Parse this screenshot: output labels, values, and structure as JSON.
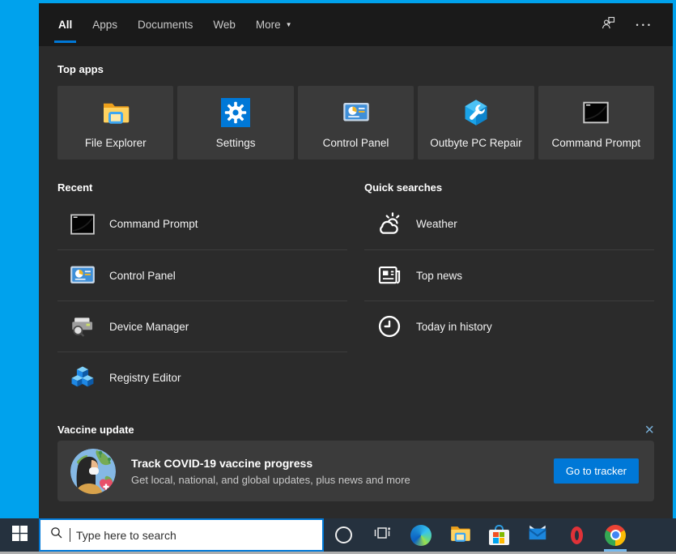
{
  "colors": {
    "desktop_blue": "#00a2ed",
    "accent_blue": "#0078d7",
    "panel_bg": "#2b2b2b",
    "tabbar_bg": "#1a1a1a",
    "tile_bg": "#3a3a3a",
    "taskbar_bg": "#25313e",
    "active_app_underline": "#76b9ed",
    "close_icon_blue": "#78aed6"
  },
  "search_panel": {
    "tabs": [
      {
        "label": "All",
        "active": true
      },
      {
        "label": "Apps",
        "active": false
      },
      {
        "label": "Documents",
        "active": false
      },
      {
        "label": "Web",
        "active": false
      },
      {
        "label": "More",
        "active": false,
        "dropdown_glyph": "▼"
      }
    ],
    "header": {
      "feedback_icon": "user-feedback-icon",
      "ellipsis_glyph": "•••"
    },
    "top_apps": {
      "title": "Top apps",
      "tiles": [
        {
          "label": "File Explorer",
          "icon": "file-explorer-icon"
        },
        {
          "label": "Settings",
          "icon": "settings-gear-icon"
        },
        {
          "label": "Control Panel",
          "icon": "control-panel-icon"
        },
        {
          "label": "Outbyte PC Repair",
          "icon": "outbyte-wrench-icon"
        },
        {
          "label": "Command Prompt",
          "icon": "command-prompt-icon"
        }
      ]
    },
    "recent": {
      "title": "Recent",
      "items": [
        {
          "label": "Command Prompt",
          "icon": "command-prompt-icon"
        },
        {
          "label": "Control Panel",
          "icon": "control-panel-icon"
        },
        {
          "label": "Device Manager",
          "icon": "device-manager-icon"
        },
        {
          "label": "Registry Editor",
          "icon": "registry-cubes-icon"
        }
      ]
    },
    "quick_searches": {
      "title": "Quick searches",
      "items": [
        {
          "label": "Weather",
          "icon": "weather-sun-cloud-icon"
        },
        {
          "label": "Top news",
          "icon": "newspaper-icon"
        },
        {
          "label": "Today in history",
          "icon": "history-clock-icon"
        }
      ]
    },
    "vaccine_update": {
      "title": "Vaccine update",
      "close_glyph": "×",
      "card": {
        "headline": "Track COVID-19 vaccine progress",
        "subtext": "Get local, national, and global updates, plus news and more",
        "button_label": "Go to tracker",
        "illustration": "covid-globe-nurse-illustration"
      }
    }
  },
  "taskbar": {
    "search": {
      "placeholder": "Type here to search"
    },
    "buttons": [
      {
        "name": "start-button",
        "icon": "windows-logo-icon"
      },
      {
        "name": "taskbar-search-input",
        "icon": "magnifier-icon"
      },
      {
        "name": "cortana-button",
        "icon": "cortana-ring-icon"
      },
      {
        "name": "task-view-button",
        "icon": "task-view-icon"
      },
      {
        "name": "edge-button",
        "icon": "edge-browser-icon"
      },
      {
        "name": "file-explorer-button",
        "icon": "folder-icon"
      },
      {
        "name": "store-button",
        "icon": "microsoft-store-icon"
      },
      {
        "name": "mail-button",
        "icon": "mail-envelope-icon"
      },
      {
        "name": "opera-button",
        "icon": "opera-icon"
      },
      {
        "name": "chrome-button",
        "icon": "chrome-icon",
        "active": true
      }
    ]
  }
}
